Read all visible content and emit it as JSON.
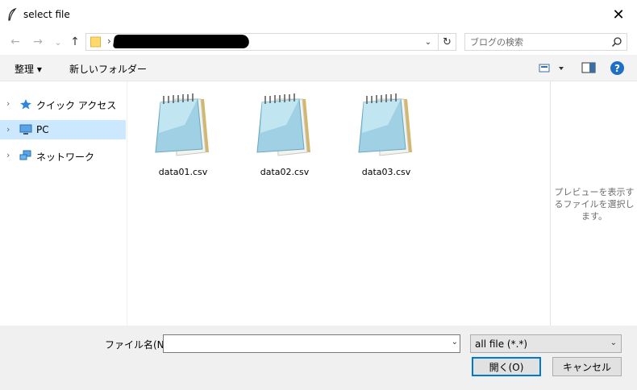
{
  "window": {
    "title": "select file"
  },
  "nav": {
    "back": "←",
    "forward": "→",
    "recent": "⌄",
    "up": "↑",
    "address_dropdown": "⌄",
    "refresh": "↻"
  },
  "search": {
    "placeholder": "ブログの検索"
  },
  "toolbar": {
    "organize": "整理 ▾",
    "new_folder": "新しいフォルダー"
  },
  "sidebar": {
    "items": [
      {
        "label": "クイック アクセス",
        "icon": "star-icon"
      },
      {
        "label": "PC",
        "icon": "computer-icon"
      },
      {
        "label": "ネットワーク",
        "icon": "network-icon"
      }
    ]
  },
  "files": [
    {
      "name": "data01.csv",
      "icon": "notepad-icon"
    },
    {
      "name": "data02.csv",
      "icon": "notepad-icon"
    },
    {
      "name": "data03.csv",
      "icon": "notepad-icon"
    }
  ],
  "preview": {
    "message": "プレビューを表示するファイルを選択します。"
  },
  "footer": {
    "filename_label": "ファイル名(N):",
    "filename_value": "",
    "filetype_value": "all file (*.*)",
    "open_label": "開く(O)",
    "cancel_label": "キャンセル"
  },
  "colors": {
    "selected_bg": "#cce8ff",
    "accent": "#0078d7",
    "help": "#1f6fc5"
  }
}
